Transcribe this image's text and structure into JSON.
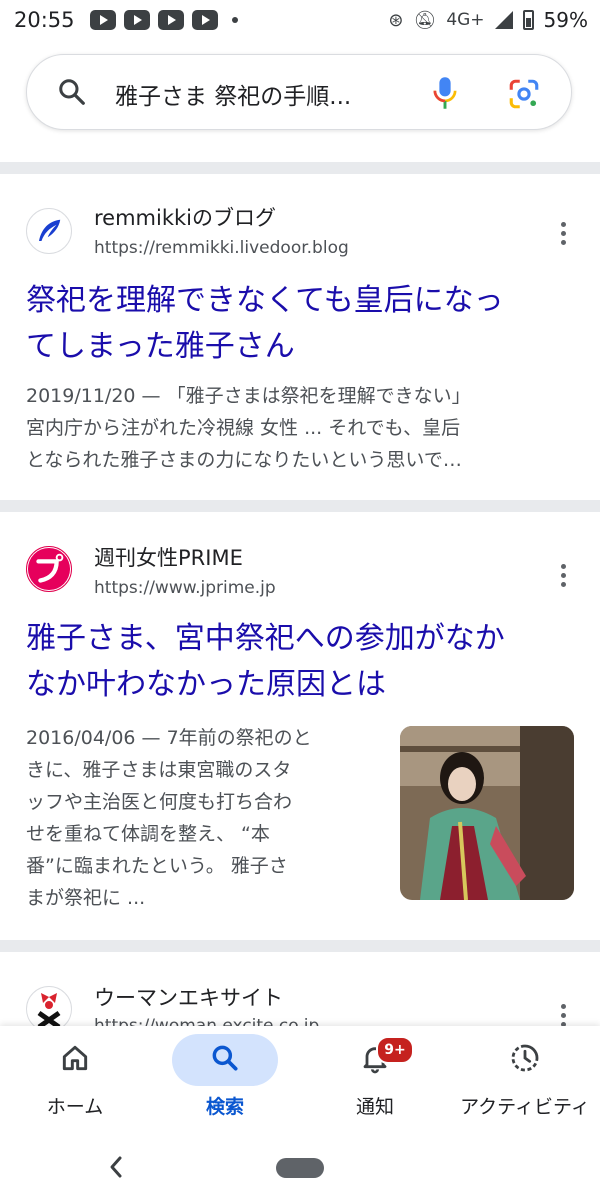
{
  "status_bar": {
    "time": "20:55",
    "network": "4G+",
    "battery": "59%"
  },
  "search": {
    "query": "雅子さま 祭祀の手順..."
  },
  "results": [
    {
      "site_name": "remmikkiのブログ",
      "url": "https://remmikki.livedoor.blog",
      "title_line1": "祭祀を理解できなくても皇后になっ",
      "title_line2": "てしまった雅子さん",
      "snippet_line1": "2019/11/20 — 「雅子さまは祭祀を理解できない」",
      "snippet_line2": "宮内庁から注がれた冷視線 女性 ... それでも、皇后",
      "snippet_line3": "となられた雅子さまの力になりたいという思いで…"
    },
    {
      "site_name": "週刊女性PRIME",
      "url": "https://www.jprime.jp",
      "title_line1": "雅子さま、宮中祭祀への参加がなか",
      "title_line2": "なか叶わなかった原因とは",
      "snippet_lines": [
        "2016/04/06 — 7年前の祭祀のと",
        "きに、雅子さまは東宮職のスタ",
        "ッフや主治医と何度も打ち合わ",
        "せを重ねて体調を整え、 “本",
        "番”に臨まれたという。 雅子さ",
        "まが祭祀に ..."
      ]
    },
    {
      "site_name": "ウーマンエキサイト",
      "url": "https://woman.excite.co.jp"
    }
  ],
  "bottom_nav": {
    "home": "ホーム",
    "search": "検索",
    "notifications": "通知",
    "notifications_badge": "9+",
    "activity": "アクティビティ"
  },
  "colors": {
    "link_title": "#1a0dab",
    "active_nav": "#0b57d0",
    "active_pill": "#d3e3fd",
    "badge": "#c5221f"
  }
}
